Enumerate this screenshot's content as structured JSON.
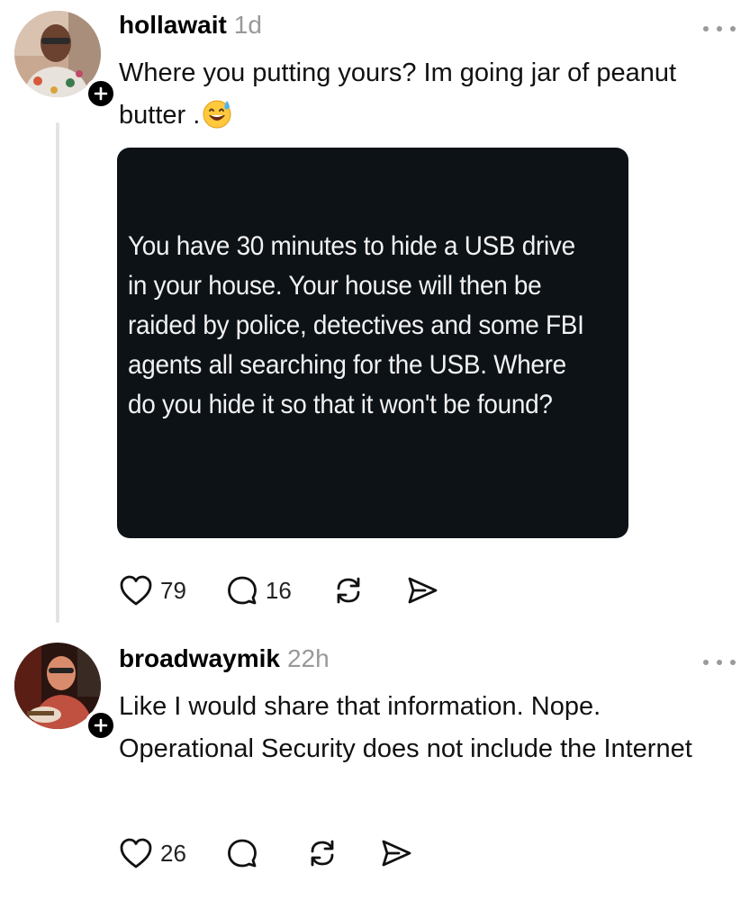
{
  "posts": [
    {
      "username": "hollawait",
      "time": "1d",
      "text": "Where you putting yours? Im going jar of peanut butter .",
      "emoji": "grinning-sweat-emoji",
      "media_text": "You have 30 minutes to hide a USB drive in your house. Your house will then be raided by police, detectives and some FBI agents all searching for the USB. Where do you hide it so that it won't be found?",
      "likes": "79",
      "replies": "16"
    },
    {
      "username": "broadwaymik",
      "time": "22h",
      "text": "Like I would share that information. Nope. Operational Security does not include the Internet",
      "likes": "26",
      "replies": ""
    }
  ],
  "icons": {
    "like": "heart-icon",
    "reply": "speech-bubble-icon",
    "repost": "repost-arrows-icon",
    "share": "send-icon",
    "more": "more-dots-icon",
    "follow": "plus-icon"
  },
  "colors": {
    "text": "#000000",
    "muted": "#999999",
    "media_bg": "#0d1217",
    "thread_line": "#e3e3e3"
  }
}
